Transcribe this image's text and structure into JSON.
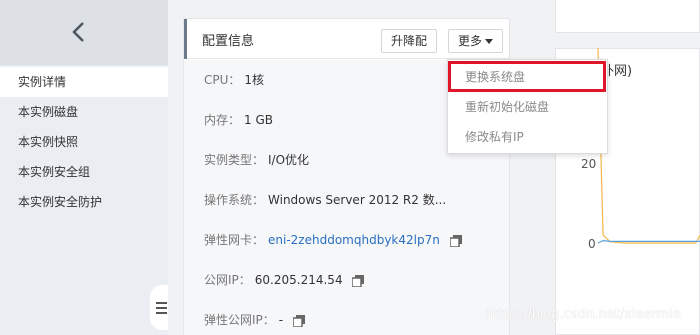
{
  "sidebar": {
    "items": [
      {
        "label": "实例详情",
        "active": true
      },
      {
        "label": "本实例磁盘",
        "active": false
      },
      {
        "label": "本实例快照",
        "active": false
      },
      {
        "label": "本实例安全组",
        "active": false
      },
      {
        "label": "本实例安全防护",
        "active": false
      }
    ]
  },
  "config": {
    "title": "配置信息",
    "upgrade_label": "升降配",
    "more_label": "更多",
    "rows": {
      "cpu": {
        "key": "CPU：",
        "value": "1核"
      },
      "mem": {
        "key": "内存：",
        "value": "1 GB"
      },
      "type": {
        "key": "实例类型：",
        "value": "I/O优化"
      },
      "os": {
        "key": "操作系统：",
        "value": "Windows Server 2012 R2 数..."
      },
      "eni": {
        "key": "弹性网卡：",
        "value": "eni-2zehddomqhdbyk42lp7n"
      },
      "ip": {
        "key": "公网IP：",
        "value": "60.205.214.54"
      },
      "eip": {
        "key": "弹性公网IP：",
        "value": "-"
      }
    }
  },
  "dropdown": {
    "items": [
      "更换系统盘",
      "重新初始化磁盘",
      "修改私有IP"
    ]
  },
  "chart": {
    "title_fragment": "外网)",
    "yticks": [
      "20",
      "0"
    ]
  },
  "chart_data": {
    "type": "line",
    "title": "",
    "xlabel": "",
    "ylabel": "",
    "yticks": [
      0,
      20
    ],
    "series": [
      {
        "color": "#f2b84b",
        "values": [
          58,
          2,
          0.3,
          0,
          0,
          0,
          0,
          0,
          2
        ]
      },
      {
        "color": "#5aa2e0",
        "values": [
          0,
          0.6,
          0.4,
          0.4,
          0.4,
          0.4,
          0.4,
          0.4,
          0.4
        ]
      }
    ]
  },
  "watermark": "https://blog.csdn.net/xiaermie",
  "colors": {
    "accent_link": "#2b6fc2",
    "highlight_border": "#e0152a",
    "sidebar_bg": "#eaedf1"
  }
}
